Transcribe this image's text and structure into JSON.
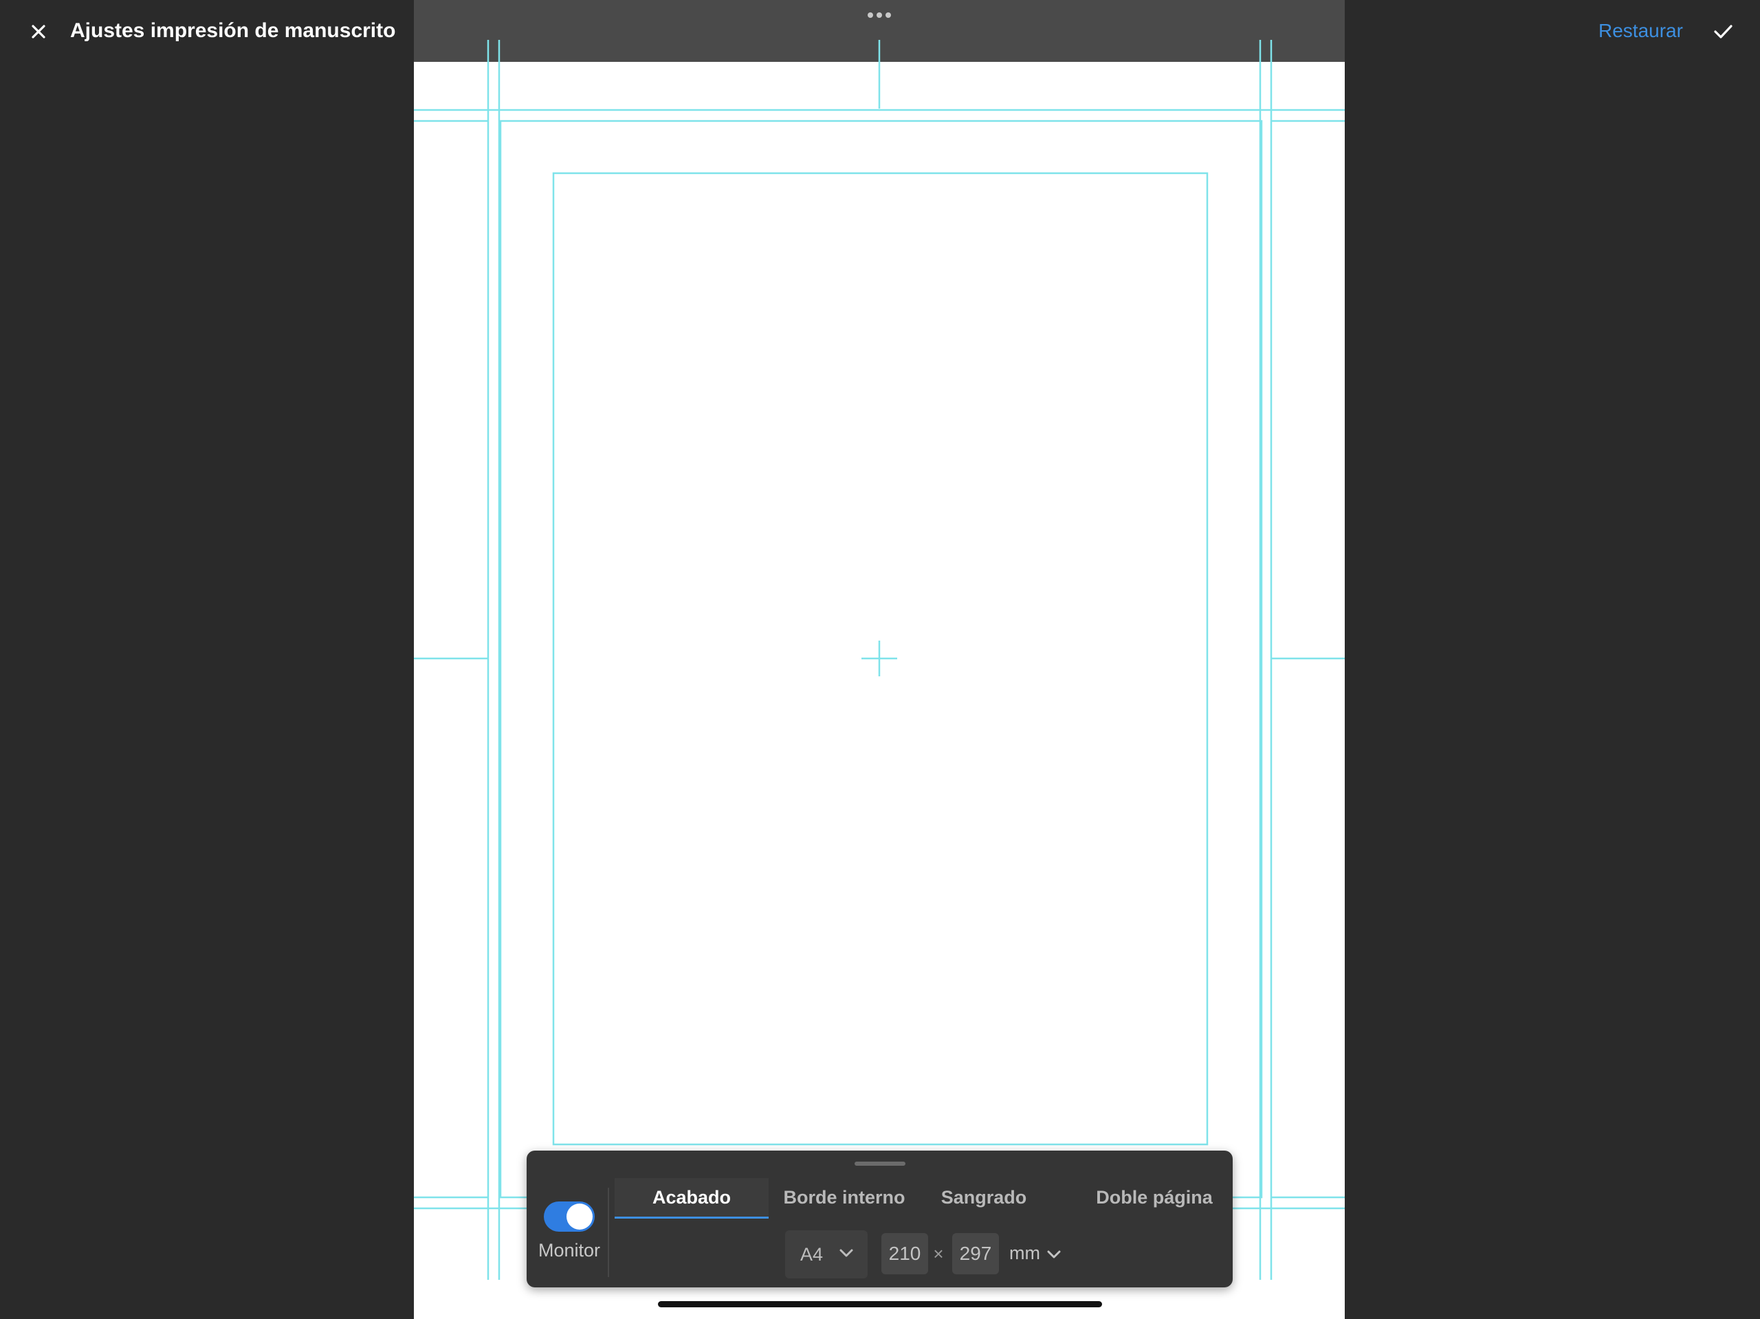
{
  "header": {
    "title": "Ajustes impresión de manuscrito",
    "close_icon": "close-icon",
    "restore_label": "Restaurar",
    "confirm_icon": "checkmark-icon",
    "accent_color": "#3d8fe0"
  },
  "canvas": {
    "menu_icon": "more-horizontal-icon",
    "guide_color": "#7fe3ea",
    "background": "#ffffff"
  },
  "panel": {
    "monitor": {
      "label": "Monitor",
      "enabled": true
    },
    "tabs": [
      {
        "label": "Acabado",
        "active": true
      },
      {
        "label": "Borde interno",
        "active": false
      },
      {
        "label": "Sangrado",
        "active": false
      },
      {
        "label": "Doble página",
        "active": false
      }
    ],
    "paper_size": "A4",
    "width": "210",
    "height": "297",
    "times_symbol": "×",
    "unit": "mm"
  }
}
